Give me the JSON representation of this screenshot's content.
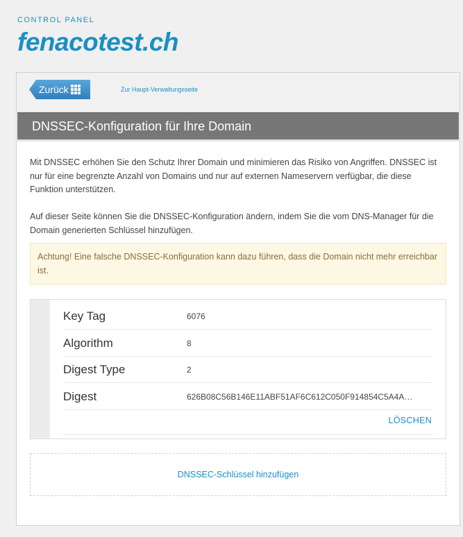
{
  "brand": {
    "small_label": "CONTROL PANEL",
    "title": "fenacotest.ch"
  },
  "topbar": {
    "back_label": "Zurück",
    "main_link": "Zur Haupt-Verwaltungsseite"
  },
  "page": {
    "title": "DNSSEC-Konfiguration für Ihre Domain",
    "intro_1": "Mit DNSSEC erhöhen Sie den Schutz Ihrer Domain und minimieren das Risiko von Angriffen. DNSSEC ist nur für eine begrenzte Anzahl von Domains und nur auf externen Nameservern verfügbar, die diese Funktion unterstützen.",
    "intro_2": "Auf dieser Seite können Sie die DNSSEC-Konfiguration ändern, indem Sie die vom DNS-Manager für die Domain generierten Schlüssel hinzufügen.",
    "warning": "Achtung! Eine falsche DNSSEC-Konfiguration kann dazu führen, dass die Domain nicht mehr erreichbar ist."
  },
  "key": {
    "rows": [
      {
        "label": "Key Tag",
        "value": "6076"
      },
      {
        "label": "Algorithm",
        "value": "8"
      },
      {
        "label": "Digest Type",
        "value": "2"
      },
      {
        "label": "Digest",
        "value": "626B08C56B146E11ABF51AF6C612C050F914854C5A4A…"
      }
    ],
    "delete_label": "LÖSCHEN"
  },
  "add_key_label": "DNSSEC-Schlüssel hinzufügen",
  "colors": {
    "accent": "#1a8fc4",
    "header_bg": "#777777",
    "warning_bg": "#fcf8e3",
    "warning_text": "#8a6d3b"
  }
}
